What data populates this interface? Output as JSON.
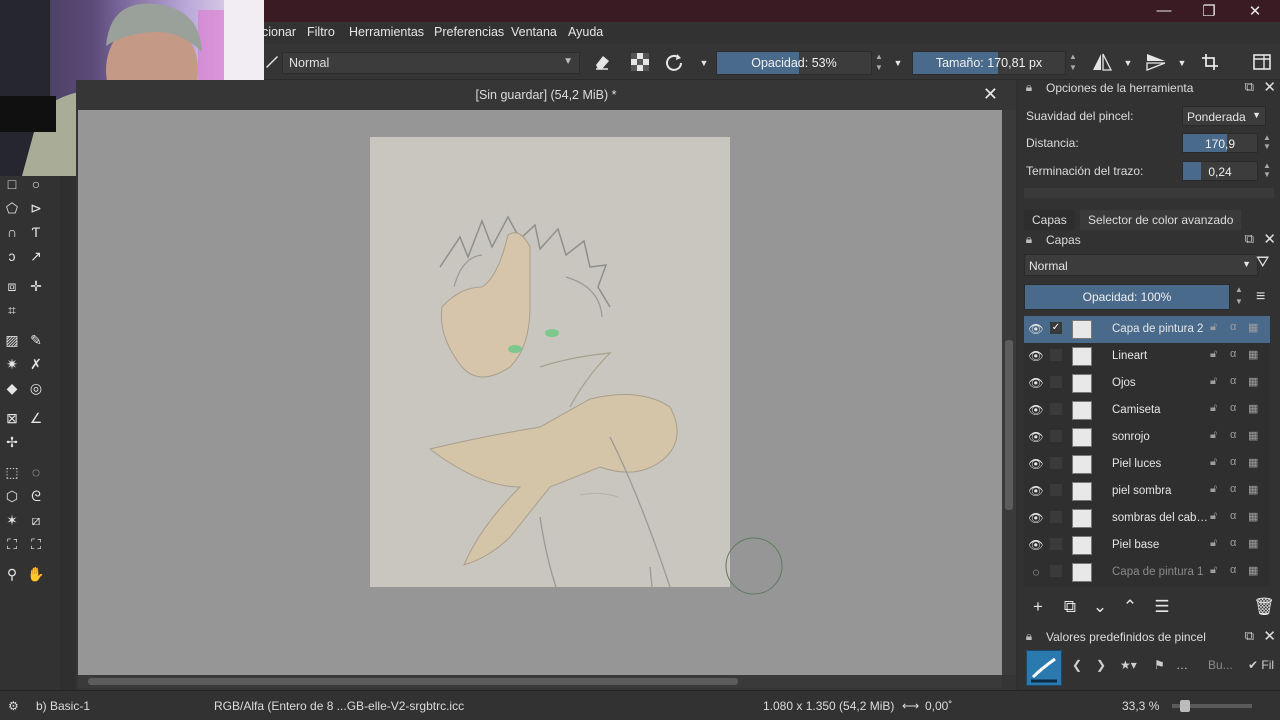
{
  "menu": {
    "items": [
      "cionar",
      "Filtro",
      "Herramientas",
      "Preferencias",
      "Ventana",
      "Ayuda"
    ]
  },
  "window_controls": {
    "minimize": "—",
    "maximize": "❐",
    "close": "✕"
  },
  "tool_options": {
    "blend_mode": "Normal",
    "opacity_label": "Opacidad: 53%",
    "opacity_value": 53,
    "size_label": "Tamaño: 170,81 px",
    "size_value": 170.81
  },
  "document": {
    "title": "[Sin guardar]  (54,2 MiB) *",
    "close": "✕"
  },
  "tool_options_docker": {
    "title": "Opciones de la herramienta",
    "rows": [
      {
        "label": "Suavidad del pincel:",
        "value": "Ponderada"
      },
      {
        "label": "Distancia:",
        "value": "170,9"
      },
      {
        "label": "Terminación del trazo:",
        "value": "0,24"
      }
    ]
  },
  "docker_tabs": [
    "Capas",
    "Selector de color avanzado"
  ],
  "layers_docker": {
    "title": "Capas",
    "blend_mode": "Normal",
    "opacity_label": "Opacidad:  100%",
    "layers": [
      {
        "name": "Capa de pintura 2",
        "active": true,
        "visible": true,
        "checked": true
      },
      {
        "name": "Lineart",
        "active": false,
        "visible": true,
        "checked": false
      },
      {
        "name": "Ojos",
        "active": false,
        "visible": true,
        "checked": false
      },
      {
        "name": "Camiseta",
        "active": false,
        "visible": true,
        "checked": false
      },
      {
        "name": "sonrojo",
        "active": false,
        "visible": true,
        "checked": false
      },
      {
        "name": "Piel luces",
        "active": false,
        "visible": true,
        "checked": false
      },
      {
        "name": "piel sombra",
        "active": false,
        "visible": true,
        "checked": false
      },
      {
        "name": "sombras del cab…",
        "active": false,
        "visible": true,
        "checked": false
      },
      {
        "name": "Piel base",
        "active": false,
        "visible": true,
        "checked": false
      },
      {
        "name": "Capa de pintura 1",
        "active": false,
        "visible": false,
        "checked": false
      }
    ]
  },
  "presets_docker": {
    "title": "Valores predefinidos de pincel",
    "search_placeholder": "Bu...",
    "filter_label": "Fil"
  },
  "status": {
    "brush": "b) Basic-1",
    "color_profile": "RGB/Alfa (Entero de 8 ...GB-elle-V2-srgbtrc.icc",
    "dimensions": "1.080 x 1.350 (54,2 MiB)",
    "rotation": "0,00˚",
    "zoom": "33,3 %"
  },
  "colors": {
    "accent": "#4a6a8c",
    "titlebar": "#3a1b24",
    "canvas_bg": "#969696",
    "paper": "#c8c6bf"
  }
}
